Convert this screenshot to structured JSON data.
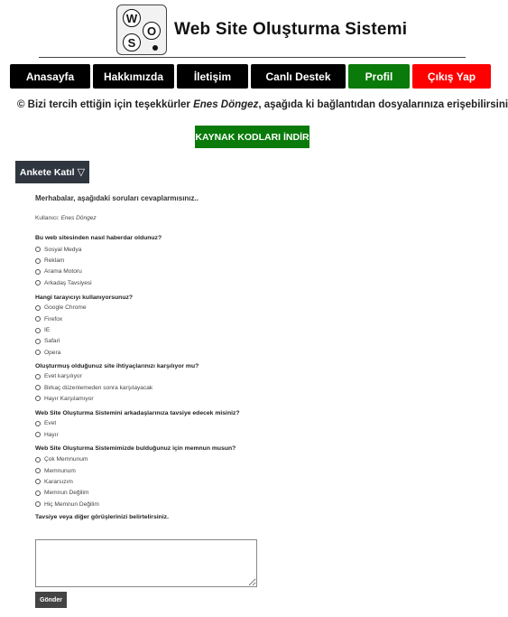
{
  "header": {
    "logo_letters": [
      "W",
      "O",
      "S"
    ],
    "title": "Web Site Oluşturma Sistemi"
  },
  "nav": {
    "items": [
      {
        "label": "Anasayfa"
      },
      {
        "label": "Hakkımızda"
      },
      {
        "label": "İletişim"
      },
      {
        "label": "Canlı Destek"
      },
      {
        "label": "Profil"
      },
      {
        "label": "Çıkış Yap"
      }
    ],
    "colors": {
      "default": "#000000",
      "profile": "#0a7a0a",
      "logout": "#ff0000"
    }
  },
  "welcome": {
    "icon": "copyright-icon",
    "symbol": "©",
    "prefix": " Bizi tercih ettiğin için teşekkürler ",
    "user": "Enes Döngez",
    "suffix": ", aşağıda ki bağlantıdan dosyalarınıza erişebilirsiniz..."
  },
  "download_button": "KAYNAK KODLARI İNDİR",
  "survey_toggle": {
    "label": "Ankete Katıl",
    "icon": "▽"
  },
  "survey": {
    "greeting": "Merhabalar, aşağıdaki soruları cevaplarmısınız..",
    "user_label": "Kullanıcı:",
    "user_name": "Enes Döngez",
    "questions": [
      {
        "text": "Bu web sitesinden nasıl haberdar oldunuz?",
        "options": [
          "Sosyal Medya",
          "Reklam",
          "Arama Motoru",
          "Arkadaş Tavsiyesi"
        ]
      },
      {
        "text": "Hangi tarayıcıyı kullanıyorsunuz?",
        "options": [
          "Google Chrome",
          "Firefox",
          "IE",
          "Safari",
          "Opera"
        ]
      },
      {
        "text": "Oluşturmuş olduğunuz site ihtiyaçlarınızı karşılıyor mu?",
        "options": [
          "Evet karşılıyor",
          "Birkaç düzenlemeden sonra karşılayacak",
          "Hayır Karşılamıyor"
        ]
      },
      {
        "text": "Web Site Oluşturma Sistemini arkadaşlarınıza tavsiye edecek misiniz?",
        "options": [
          "Evet",
          "Hayır"
        ]
      },
      {
        "text": "Web Site Oluşturma Sistemimizde bulduğunuz için memnun musun?",
        "options": [
          "Çok Memnunum",
          "Memnunum",
          "Kararsızım",
          "Memnun Değilim",
          "Hiç Memnun Değilim"
        ]
      }
    ],
    "comment_label": "Tavsiye veya diğer görüşlerinizi belirtelirsiniz.",
    "submit": "Gönder"
  }
}
